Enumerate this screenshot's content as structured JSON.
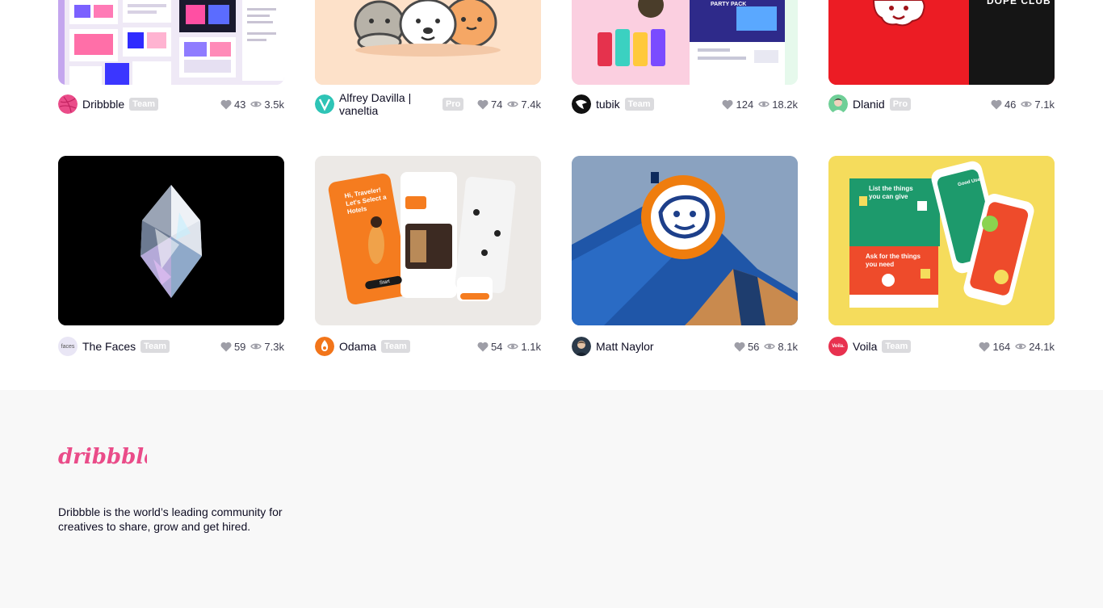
{
  "shots": [
    {
      "author": "Dribbble",
      "badge": "Team",
      "likes": "43",
      "views": "3.5k",
      "avatar_color": "#ea4c89"
    },
    {
      "author": "Alfrey Davilla | vaneltia",
      "badge": "Pro",
      "likes": "74",
      "views": "7.4k",
      "avatar_color": "#2ec4b6"
    },
    {
      "author": "tubik",
      "badge": "Team",
      "likes": "124",
      "views": "18.2k",
      "avatar_color": "#111111"
    },
    {
      "author": "Dlanid",
      "badge": "Pro",
      "likes": "46",
      "views": "7.1k",
      "avatar_color": "#6fcf97"
    },
    {
      "author": "The Faces",
      "badge": "Team",
      "likes": "59",
      "views": "7.3k",
      "avatar_color": "#e9e6f5",
      "avatar_text": "faces"
    },
    {
      "author": "Odama",
      "badge": "Team",
      "likes": "54",
      "views": "1.1k",
      "avatar_color": "#f2751a"
    },
    {
      "author": "Matt Naylor",
      "badge": "",
      "likes": "56",
      "views": "8.1k",
      "avatar_color": "#2b3a4a"
    },
    {
      "author": "Voila",
      "badge": "Team",
      "likes": "164",
      "views": "24.1k",
      "avatar_color": "#e8314f",
      "avatar_text": "Voila."
    }
  ],
  "thumb_text": {
    "dope_club": "DOPE CLUB",
    "party_pack": "PARTY PACK",
    "hi_traveler": "Hi, Traveler! Let's Select a Hotels",
    "start": "Start",
    "list_things": "List the things you can give",
    "ask_things": "Ask for the things you need",
    "good_use": "Good Use"
  },
  "footer": {
    "logo": "dribbble",
    "description": "Dribbble is the world’s leading community for creatives to share, grow and get hired."
  },
  "colors": {
    "brand_pink": "#ea4c89",
    "footer_bg": "#f8f8f8",
    "badge_bg": "#dbdbde"
  }
}
